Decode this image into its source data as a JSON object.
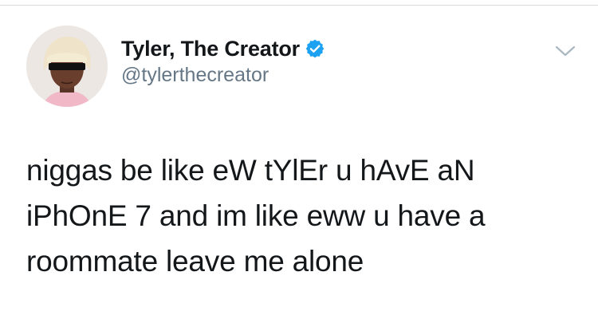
{
  "author": {
    "display_name": "Tyler, The Creator",
    "handle": "@tylerthecreator",
    "verified": true
  },
  "tweet": {
    "text": "niggas be like eW tYlEr u hAvE aN\niPhOnE 7 and im like eww u have a\nroommate leave me alone"
  },
  "icons": {
    "verified": "verified-badge-icon",
    "menu": "chevron-down-icon",
    "avatar": "profile-avatar"
  },
  "colors": {
    "text": "#14171a",
    "secondary_text": "#657786",
    "verified_blue": "#1da1f2",
    "caret": "#aab8c2"
  }
}
